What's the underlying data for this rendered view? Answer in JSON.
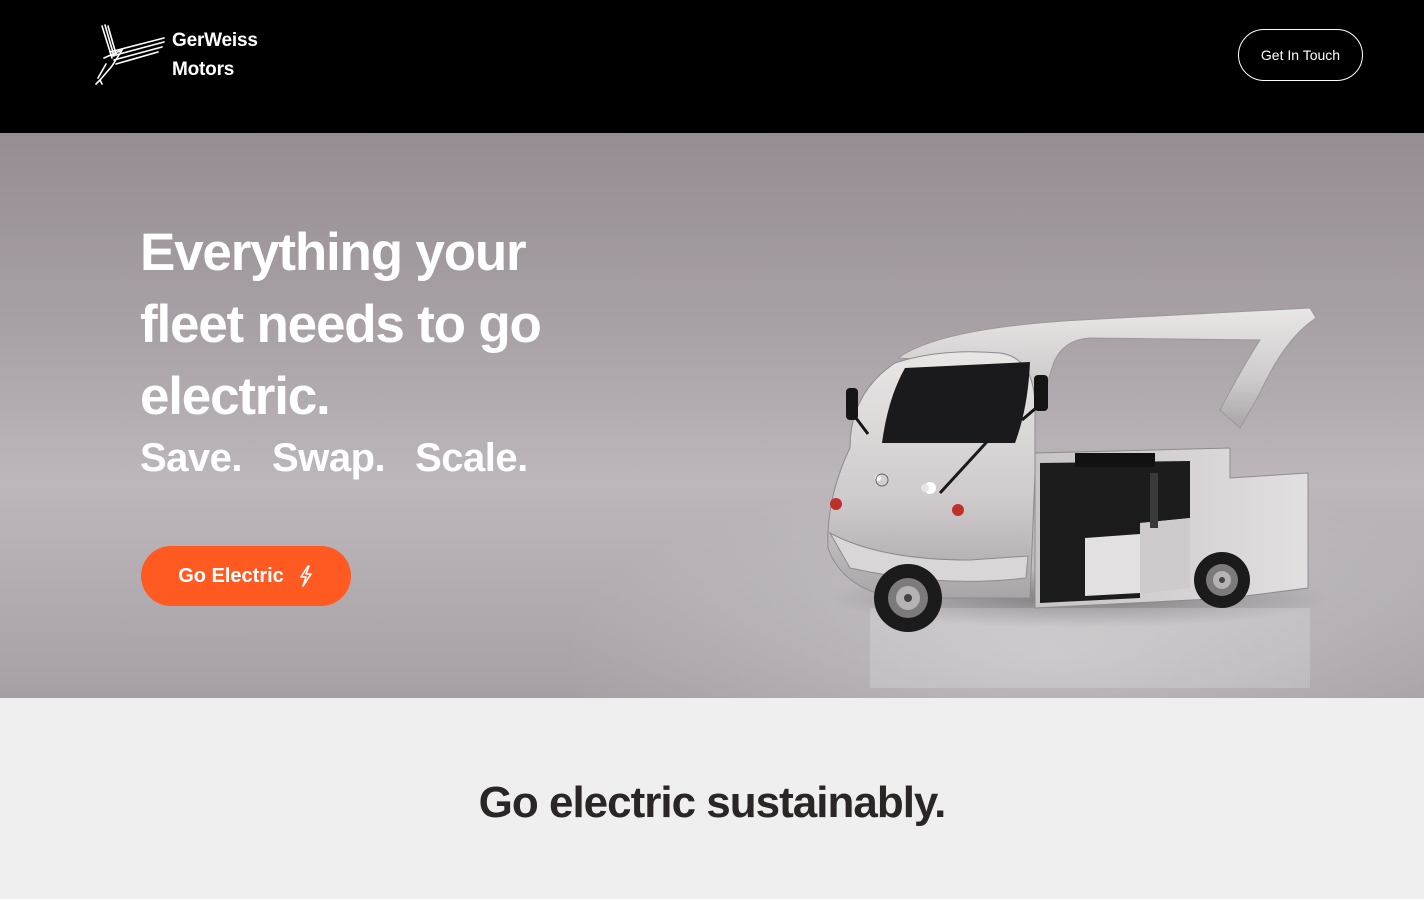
{
  "header": {
    "brand_line1": "GerWeiss",
    "brand_line2": "Motors",
    "logo_icon": "bird-logo-icon",
    "contact_label": "Get In Touch"
  },
  "hero": {
    "title": "Everything your fleet needs to go electric.",
    "tagline": [
      "Save.",
      "Swap.",
      "Scale."
    ],
    "cta_label": "Go Electric",
    "cta_icon": "lightning-bolt-icon",
    "image": "electric-rickshaw-vehicle"
  },
  "section": {
    "title": "Go electric sustainably."
  },
  "colors": {
    "header_bg": "#000000",
    "accent": "#ff5a22",
    "section_bg": "#efefef",
    "heading_dark": "#2a2626"
  }
}
